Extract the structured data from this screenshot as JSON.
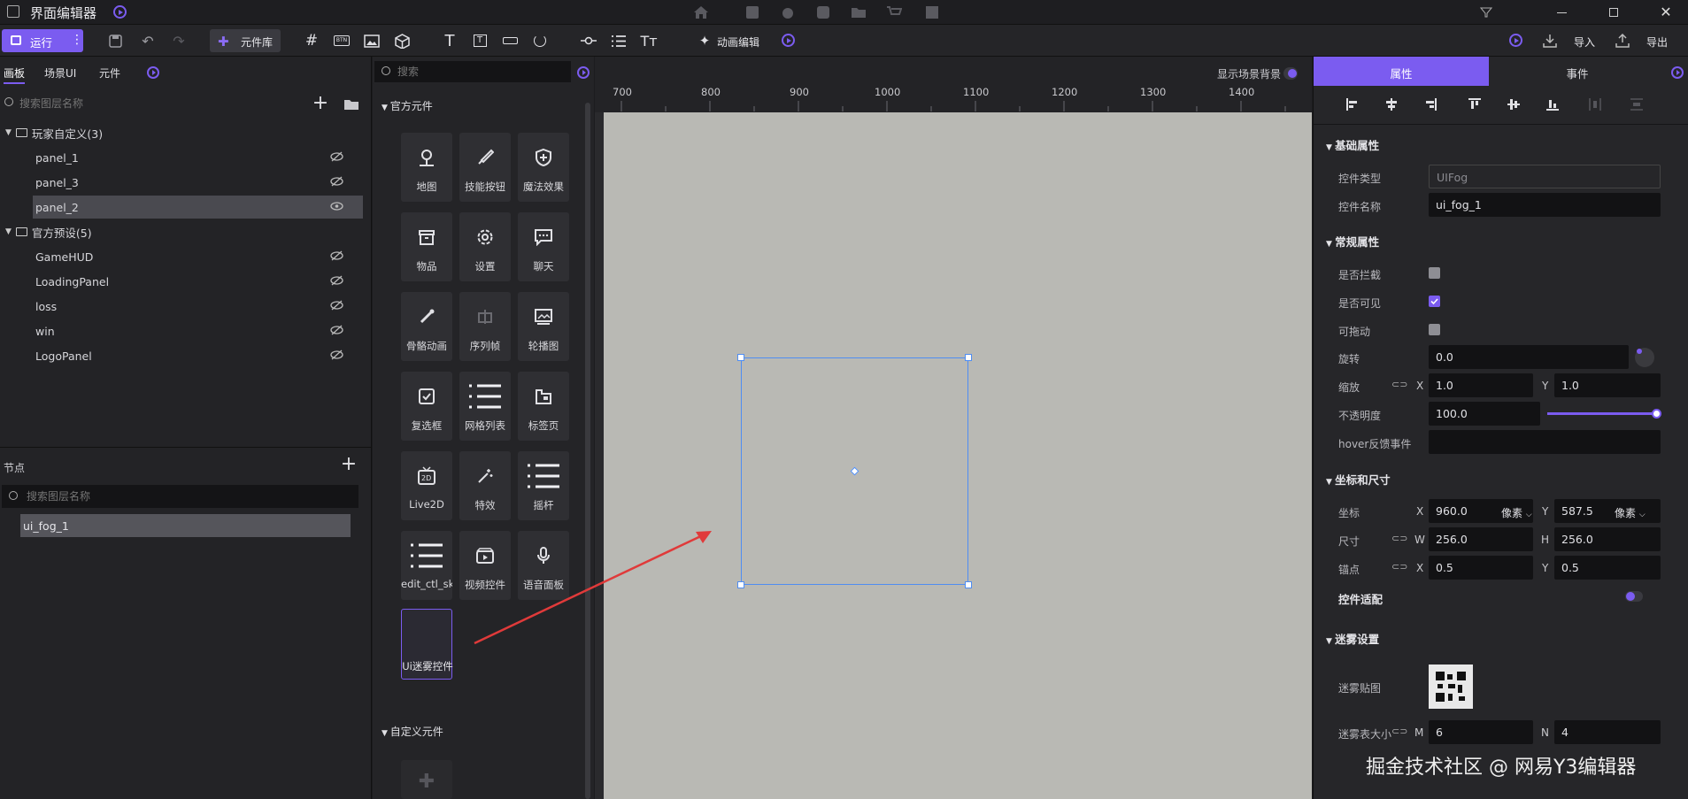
{
  "app": {
    "title": "界面编辑器"
  },
  "toolbar": {
    "run_label": "运行",
    "component_lib_label": "元件库",
    "anim_edit_label": "动画编辑",
    "import_label": "导入",
    "export_label": "导出"
  },
  "left": {
    "tabs": [
      "画板",
      "场景UI",
      "元件"
    ],
    "search_placeholder": "搜索图层名称",
    "groups": [
      {
        "name": "玩家自定义(3)",
        "items": [
          "panel_1",
          "panel_3",
          "panel_2"
        ]
      },
      {
        "name": "官方预设(5)",
        "items": [
          "GameHUD",
          "LoadingPanel",
          "loss",
          "win",
          "LogoPanel"
        ]
      }
    ],
    "nodes_title": "节点",
    "nodes_search_placeholder": "搜索图层名称",
    "nodes": [
      "ui_fog_1"
    ]
  },
  "components": {
    "search_placeholder": "搜索",
    "official_title": "官方元件",
    "items": [
      "地图",
      "技能按钮",
      "魔法效果",
      "物品",
      "设置",
      "聊天",
      "骨骼动画",
      "序列帧",
      "轮播图",
      "复选框",
      "网格列表",
      "标签页",
      "Live2D",
      "特效",
      "摇杆",
      "edit_ctl_ski",
      "视频控件",
      "语音面板",
      "Ui迷雾控件"
    ],
    "custom_title": "自定义元件"
  },
  "canvas": {
    "show_bg_label": "显示场景背景",
    "ruler_ticks": [
      "700",
      "800",
      "900",
      "1000",
      "1100",
      "1200",
      "1300",
      "1400"
    ]
  },
  "props": {
    "tab_props": "属性",
    "tab_events": "事件",
    "basic_title": "基础属性",
    "ctrl_type_label": "控件类型",
    "ctrl_type_value": "UIFog",
    "ctrl_name_label": "控件名称",
    "ctrl_name_value": "ui_fog_1",
    "common_title": "常规属性",
    "intercept_label": "是否拦截",
    "visible_label": "是否可见",
    "draggable_label": "可拖动",
    "rotation_label": "旋转",
    "rotation_value": "0.0",
    "scale_label": "缩放",
    "scale_x": "1.0",
    "scale_y": "1.0",
    "opacity_label": "不透明度",
    "opacity_value": "100.0",
    "opacity_level": 1.0,
    "hover_label": "hover反馈事件",
    "coord_title": "坐标和尺寸",
    "pos_label": "坐标",
    "pos_x": "960.0",
    "pos_y": "587.5",
    "unit": "像素",
    "size_label": "尺寸",
    "size_w": "256.0",
    "size_h": "256.0",
    "anchor_label": "锚点",
    "anchor_x": "0.5",
    "anchor_y": "0.5",
    "fit_label": "控件适配",
    "fog_title": "迷雾设置",
    "fog_tex_label": "迷雾贴图",
    "fog_size_label": "迷雾表大小",
    "fog_m": "6",
    "fog_n": "4",
    "axis_x": "X",
    "axis_y": "Y",
    "axis_w": "W",
    "axis_h": "H",
    "axis_m": "M",
    "axis_n": "N"
  },
  "watermark": "掘金技术社区 @ 网易Y3编辑器",
  "colors": {
    "accent": "#7b5cf0",
    "selection": "#4f8df2",
    "arrow": "#e03a3a"
  }
}
